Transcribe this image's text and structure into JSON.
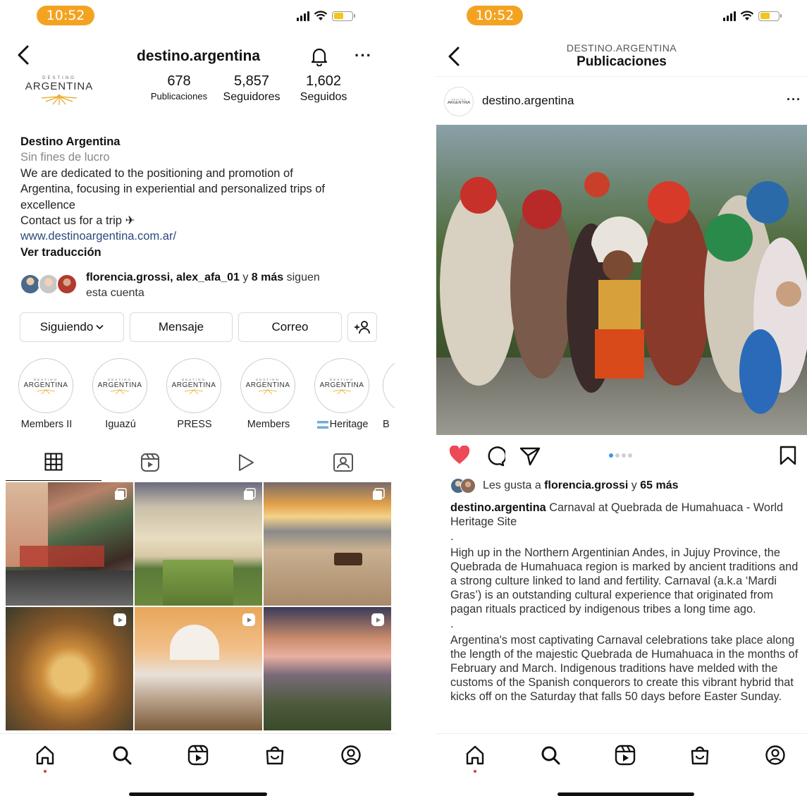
{
  "status": {
    "time": "10:52"
  },
  "profile": {
    "username": "destino.argentina",
    "logo_small": "DESTINO",
    "logo_big": "ARGENTINA",
    "stats": [
      {
        "value": "678",
        "label": "Publicaciones"
      },
      {
        "value": "5,857",
        "label": "Seguidores"
      },
      {
        "value": "1,602",
        "label": "Seguidos"
      }
    ],
    "name": "Destino Argentina",
    "category": "Sin fines de lucro",
    "bio_line1": "We are dedicated to the positioning and promotion of",
    "bio_line2": "Argentina, focusing in experiential and personalized trips of",
    "bio_line3": "excellence",
    "bio_line4": "Contact us for a trip ✈",
    "website": "www.destinoargentina.com.ar/",
    "translate": "Ver traducción",
    "followed_by": {
      "names": "florencia.grossi, alex_afa_01",
      "connector": " y ",
      "more": "8 más",
      "suffix": " siguen",
      "line2": "esta cuenta"
    },
    "buttons": {
      "following": "Siguiendo",
      "message": "Mensaje",
      "email": "Correo"
    },
    "highlights": [
      {
        "label": "Members II"
      },
      {
        "label": "Iguazú"
      },
      {
        "label": "PRESS"
      },
      {
        "label": "Members"
      },
      {
        "label": "Heritage"
      },
      {
        "label": "B"
      }
    ]
  },
  "post": {
    "header_sub": "DESTINO.ARGENTINA",
    "header_title": "Publicaciones",
    "username": "destino.argentina",
    "likes_prefix": "Les gusta a ",
    "likes_user": "florencia.grossi",
    "likes_connector": " y ",
    "likes_more": "65 más",
    "caption_user": "destino.argentina",
    "caption_title": " Carnaval at Quebrada de Humahuaca - World Heritage Site",
    "dot": ".",
    "para1": "High up in the Northern Argentinian Andes, in Jujuy Province, the Quebrada de Humahuaca region is marked by ancient traditions and a strong culture linked to land and fertility. Carnaval (a.k.a ‘Mardi Gras’) is an outstanding cultural experience that originated from pagan rituals practiced by indigenous tribes a long time ago.",
    "para2": "Argentina's most captivating Carnaval celebrations take place along the length of the majestic Quebrada de Humahuaca in the months of February and March. Indigenous traditions have melded with the customs of the Spanish conquerors to create this vibrant hybrid that kicks off on the Saturday that falls 50 days before Easter Sunday."
  },
  "colors": {
    "accent": "#f4a321",
    "like": "#ed4956",
    "link": "#2b4a7c"
  }
}
